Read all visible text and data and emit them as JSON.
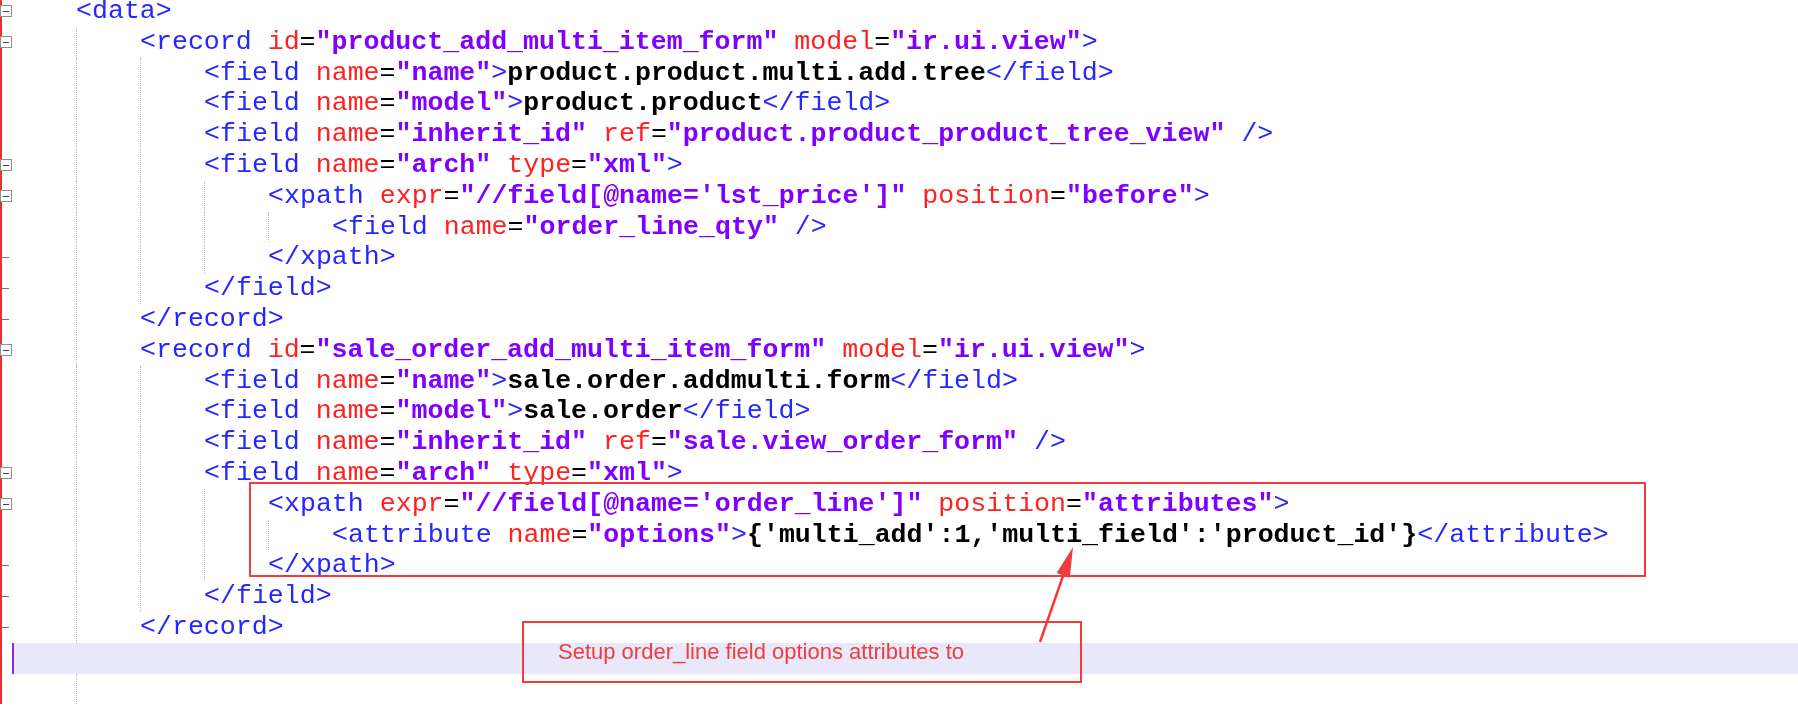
{
  "document": {
    "kind": "element",
    "open": [
      {
        "kind": "tag",
        "text": "<data>"
      }
    ],
    "children": [
      {
        "kind": "element",
        "open": [
          {
            "kind": "tag",
            "text": "<record"
          },
          {
            "kind": "attr",
            "text": " id"
          },
          {
            "kind": "eq",
            "text": "="
          },
          {
            "kind": "value",
            "text": "\"product_add_multi_item_form\""
          },
          {
            "kind": "attr",
            "text": " model"
          },
          {
            "kind": "eq",
            "text": "="
          },
          {
            "kind": "value",
            "text": "\"ir.ui.view\""
          },
          {
            "kind": "tag",
            "text": ">"
          }
        ],
        "children": [
          {
            "kind": "element",
            "open": [
              {
                "kind": "tag",
                "text": "<field"
              },
              {
                "kind": "attr",
                "text": " name"
              },
              {
                "kind": "eq",
                "text": "="
              },
              {
                "kind": "value",
                "text": "\"name\""
              },
              {
                "kind": "tag",
                "text": ">"
              },
              {
                "kind": "text",
                "text": "product.product.multi.add.tree"
              },
              {
                "kind": "tag",
                "text": "</field>"
              }
            ]
          },
          {
            "kind": "element",
            "open": [
              {
                "kind": "tag",
                "text": "<field"
              },
              {
                "kind": "attr",
                "text": " name"
              },
              {
                "kind": "eq",
                "text": "="
              },
              {
                "kind": "value",
                "text": "\"model\""
              },
              {
                "kind": "tag",
                "text": ">"
              },
              {
                "kind": "text",
                "text": "product.product"
              },
              {
                "kind": "tag",
                "text": "</field>"
              }
            ]
          },
          {
            "kind": "element",
            "open": [
              {
                "kind": "tag",
                "text": "<field"
              },
              {
                "kind": "attr",
                "text": " name"
              },
              {
                "kind": "eq",
                "text": "="
              },
              {
                "kind": "value",
                "text": "\"inherit_id\""
              },
              {
                "kind": "attr",
                "text": " ref"
              },
              {
                "kind": "eq",
                "text": "="
              },
              {
                "kind": "value",
                "text": "\"product.product_product_tree_view\""
              },
              {
                "kind": "tag",
                "text": " />"
              }
            ]
          },
          {
            "kind": "element",
            "open": [
              {
                "kind": "tag",
                "text": "<field"
              },
              {
                "kind": "attr",
                "text": " name"
              },
              {
                "kind": "eq",
                "text": "="
              },
              {
                "kind": "value",
                "text": "\"arch\""
              },
              {
                "kind": "attr",
                "text": " type"
              },
              {
                "kind": "eq",
                "text": "="
              },
              {
                "kind": "value",
                "text": "\"xml\""
              },
              {
                "kind": "tag",
                "text": ">"
              }
            ],
            "children": [
              {
                "kind": "element",
                "open": [
                  {
                    "kind": "tag",
                    "text": "<xpath"
                  },
                  {
                    "kind": "attr",
                    "text": " expr"
                  },
                  {
                    "kind": "eq",
                    "text": "="
                  },
                  {
                    "kind": "value",
                    "text": "\"//field[@name='lst_price']\""
                  },
                  {
                    "kind": "attr",
                    "text": " position"
                  },
                  {
                    "kind": "eq",
                    "text": "="
                  },
                  {
                    "kind": "value",
                    "text": "\"before\""
                  },
                  {
                    "kind": "tag",
                    "text": ">"
                  }
                ],
                "children": [
                  {
                    "kind": "element",
                    "open": [
                      {
                        "kind": "tag",
                        "text": "<field"
                      },
                      {
                        "kind": "attr",
                        "text": " name"
                      },
                      {
                        "kind": "eq",
                        "text": "="
                      },
                      {
                        "kind": "value",
                        "text": "\"order_line_qty\""
                      },
                      {
                        "kind": "tag",
                        "text": " />"
                      }
                    ]
                  }
                ],
                "close": [
                  {
                    "kind": "tag",
                    "text": "</xpath>"
                  }
                ]
              }
            ],
            "close": [
              {
                "kind": "tag",
                "text": "</field>"
              }
            ]
          }
        ],
        "close": [
          {
            "kind": "tag",
            "text": "</record>"
          }
        ]
      },
      {
        "kind": "element",
        "open": [
          {
            "kind": "tag",
            "text": "<record"
          },
          {
            "kind": "attr",
            "text": " id"
          },
          {
            "kind": "eq",
            "text": "="
          },
          {
            "kind": "value",
            "text": "\"sale_order_add_multi_item_form\""
          },
          {
            "kind": "attr",
            "text": " model"
          },
          {
            "kind": "eq",
            "text": "="
          },
          {
            "kind": "value",
            "text": "\"ir.ui.view\""
          },
          {
            "kind": "tag",
            "text": ">"
          }
        ],
        "children": [
          {
            "kind": "element",
            "open": [
              {
                "kind": "tag",
                "text": "<field"
              },
              {
                "kind": "attr",
                "text": " name"
              },
              {
                "kind": "eq",
                "text": "="
              },
              {
                "kind": "value",
                "text": "\"name\""
              },
              {
                "kind": "tag",
                "text": ">"
              },
              {
                "kind": "text",
                "text": "sale.order.addmulti.form"
              },
              {
                "kind": "tag",
                "text": "</field>"
              }
            ]
          },
          {
            "kind": "element",
            "open": [
              {
                "kind": "tag",
                "text": "<field"
              },
              {
                "kind": "attr",
                "text": " name"
              },
              {
                "kind": "eq",
                "text": "="
              },
              {
                "kind": "value",
                "text": "\"model\""
              },
              {
                "kind": "tag",
                "text": ">"
              },
              {
                "kind": "text",
                "text": "sale.order"
              },
              {
                "kind": "tag",
                "text": "</field>"
              }
            ]
          },
          {
            "kind": "element",
            "open": [
              {
                "kind": "tag",
                "text": "<field"
              },
              {
                "kind": "attr",
                "text": " name"
              },
              {
                "kind": "eq",
                "text": "="
              },
              {
                "kind": "value",
                "text": "\"inherit_id\""
              },
              {
                "kind": "attr",
                "text": " ref"
              },
              {
                "kind": "eq",
                "text": "="
              },
              {
                "kind": "value",
                "text": "\"sale.view_order_form\""
              },
              {
                "kind": "tag",
                "text": " />"
              }
            ]
          },
          {
            "kind": "element",
            "open": [
              {
                "kind": "tag",
                "text": "<field"
              },
              {
                "kind": "attr",
                "text": " name"
              },
              {
                "kind": "eq",
                "text": "="
              },
              {
                "kind": "value",
                "text": "\"arch\""
              },
              {
                "kind": "attr",
                "text": " type"
              },
              {
                "kind": "eq",
                "text": "="
              },
              {
                "kind": "value",
                "text": "\"xml\""
              },
              {
                "kind": "tag",
                "text": ">"
              }
            ],
            "children": [
              {
                "kind": "element",
                "open": [
                  {
                    "kind": "tag",
                    "text": "<xpath"
                  },
                  {
                    "kind": "attr",
                    "text": " expr"
                  },
                  {
                    "kind": "eq",
                    "text": "="
                  },
                  {
                    "kind": "value",
                    "text": "\"//field[@name='order_line']\""
                  },
                  {
                    "kind": "attr",
                    "text": " position"
                  },
                  {
                    "kind": "eq",
                    "text": "="
                  },
                  {
                    "kind": "value",
                    "text": "\"attributes\""
                  },
                  {
                    "kind": "tag",
                    "text": ">"
                  }
                ],
                "children": [
                  {
                    "kind": "element",
                    "open": [
                      {
                        "kind": "tag",
                        "text": "<attribute"
                      },
                      {
                        "kind": "attr",
                        "text": " name"
                      },
                      {
                        "kind": "eq",
                        "text": "="
                      },
                      {
                        "kind": "value",
                        "text": "\"options\""
                      },
                      {
                        "kind": "tag",
                        "text": ">"
                      },
                      {
                        "kind": "text",
                        "text": "{'multi_add':1,'multi_field':'product_id'}"
                      },
                      {
                        "kind": "tag",
                        "text": "</attribute>"
                      }
                    ]
                  }
                ],
                "close": [
                  {
                    "kind": "tag",
                    "text": "</xpath>"
                  }
                ]
              }
            ],
            "close": [
              {
                "kind": "tag",
                "text": "</field>"
              }
            ]
          }
        ],
        "close": [
          {
            "kind": "tag",
            "text": "</record>"
          }
        ]
      },
      {
        "kind": "blank",
        "current": true
      },
      {
        "kind": "blank",
        "current": false
      }
    ]
  },
  "annotation": {
    "callout": "Setup order_line field options attributes to"
  }
}
